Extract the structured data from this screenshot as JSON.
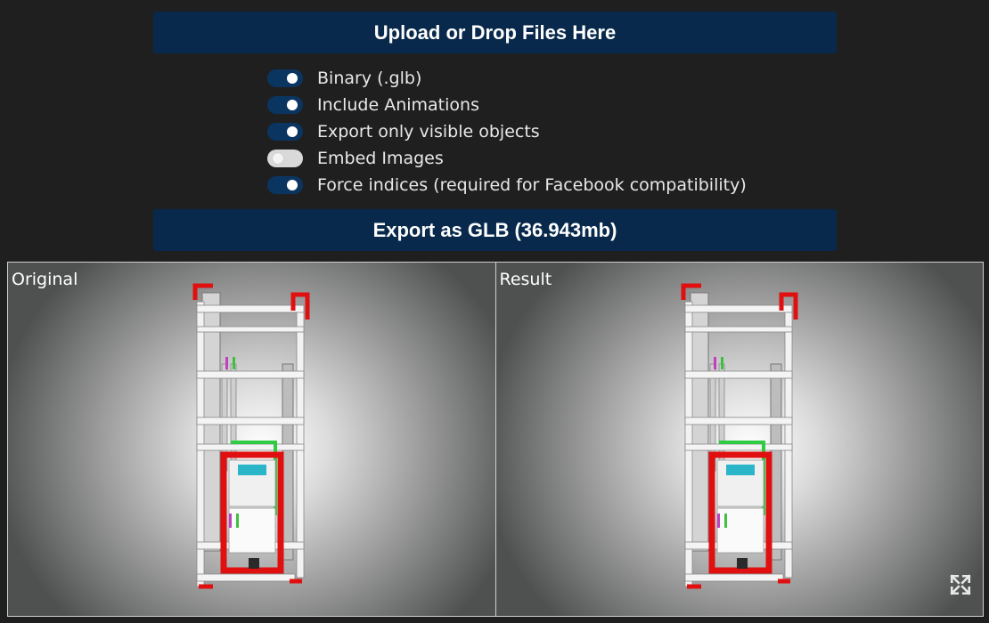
{
  "upload": {
    "label": "Upload or Drop Files Here"
  },
  "options": [
    {
      "label": "Binary (.glb)",
      "on": true
    },
    {
      "label": "Include Animations",
      "on": true
    },
    {
      "label": "Export only visible objects",
      "on": true
    },
    {
      "label": "Embed Images",
      "on": false
    },
    {
      "label": "Force indices (required for Facebook compatibility)",
      "on": true
    }
  ],
  "export": {
    "label": "Export as GLB (36.943mb)"
  },
  "viewers": {
    "original": {
      "label": "Original"
    },
    "result": {
      "label": "Result"
    },
    "fullscreen_icon": "expand-arrows-icon"
  },
  "colors": {
    "button_bg": "#08294b",
    "toggle_on": "#0b3561",
    "toggle_off": "#d9d9d9",
    "frame_red": "#e01010"
  }
}
